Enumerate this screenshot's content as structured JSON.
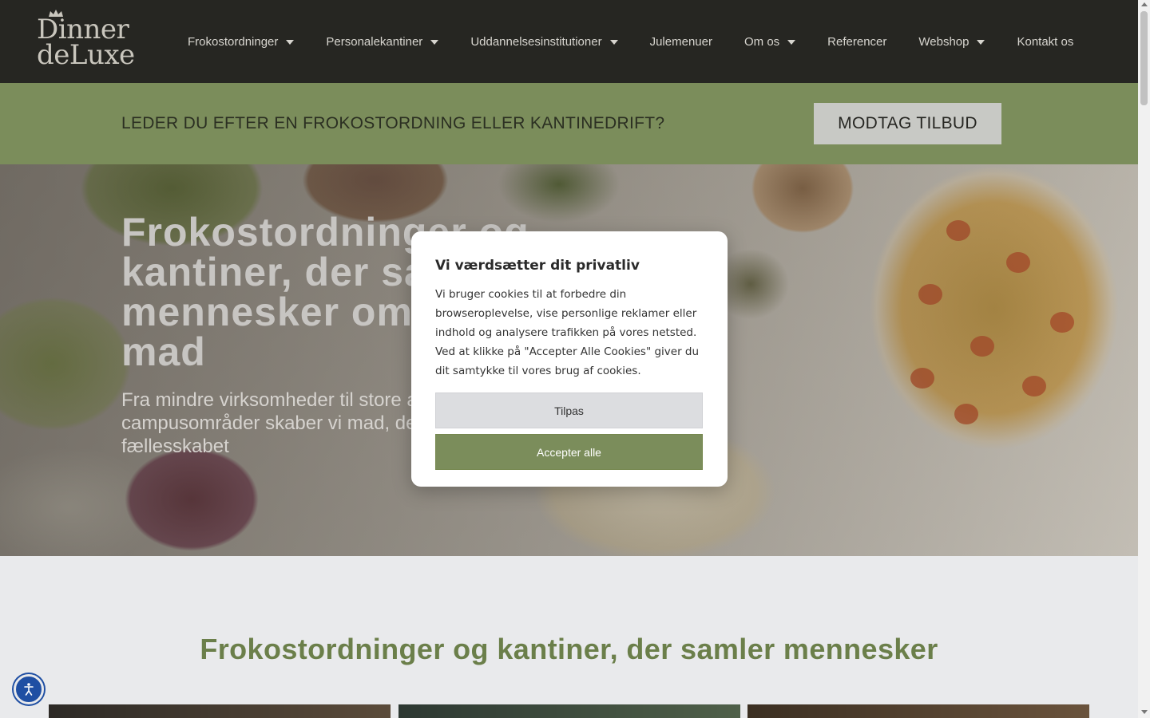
{
  "logo": {
    "line1": "Dinner",
    "line2": "deLuxe"
  },
  "nav": {
    "items": [
      {
        "label": "Frokostordninger",
        "has_dropdown": true
      },
      {
        "label": "Personalekantiner",
        "has_dropdown": true
      },
      {
        "label": "Uddannelsesinstitutioner",
        "has_dropdown": true
      },
      {
        "label": "Julemenuer",
        "has_dropdown": false
      },
      {
        "label": "Om os",
        "has_dropdown": true
      },
      {
        "label": "Referencer",
        "has_dropdown": false
      },
      {
        "label": "Webshop",
        "has_dropdown": true
      },
      {
        "label": "Kontakt os",
        "has_dropdown": false
      }
    ]
  },
  "banner": {
    "text": "LEDER DU EFTER EN FROKOSTORDNING ELLER KANTINEDRIFT?",
    "button_label": "MODTAG TILBUD"
  },
  "hero": {
    "title": "Frokostordninger og kantiner, der samler mennesker om hjemmelavet mad",
    "subtitle": "Fra mindre virksomheder til store arbejdspladser og campusområder skaber vi mad, der løfter hverdagen og styrker fællesskabet"
  },
  "cookie_modal": {
    "title": "Vi værdsætter dit privatliv",
    "body": "Vi bruger cookies til at forbedre din browseroplevelse, vise personlige reklamer eller indhold og analysere trafikken på vores netsted. Ved at klikke på \"Accepter Alle Cookies\" giver du dit samtykke til vores brug af cookies.",
    "customize_label": "Tilpas",
    "accept_label": "Accepter alle"
  },
  "section": {
    "title": "Frokostordninger og kantiner, der samler mennesker"
  },
  "colors": {
    "header_bg": "#262622",
    "accent_green": "#7b8d5b",
    "section_title": "#6b7f4a",
    "accessibility_blue": "#1f4fa3"
  },
  "icons": {
    "accessibility": "accessibility-icon",
    "dropdown": "chevron-down-icon"
  }
}
